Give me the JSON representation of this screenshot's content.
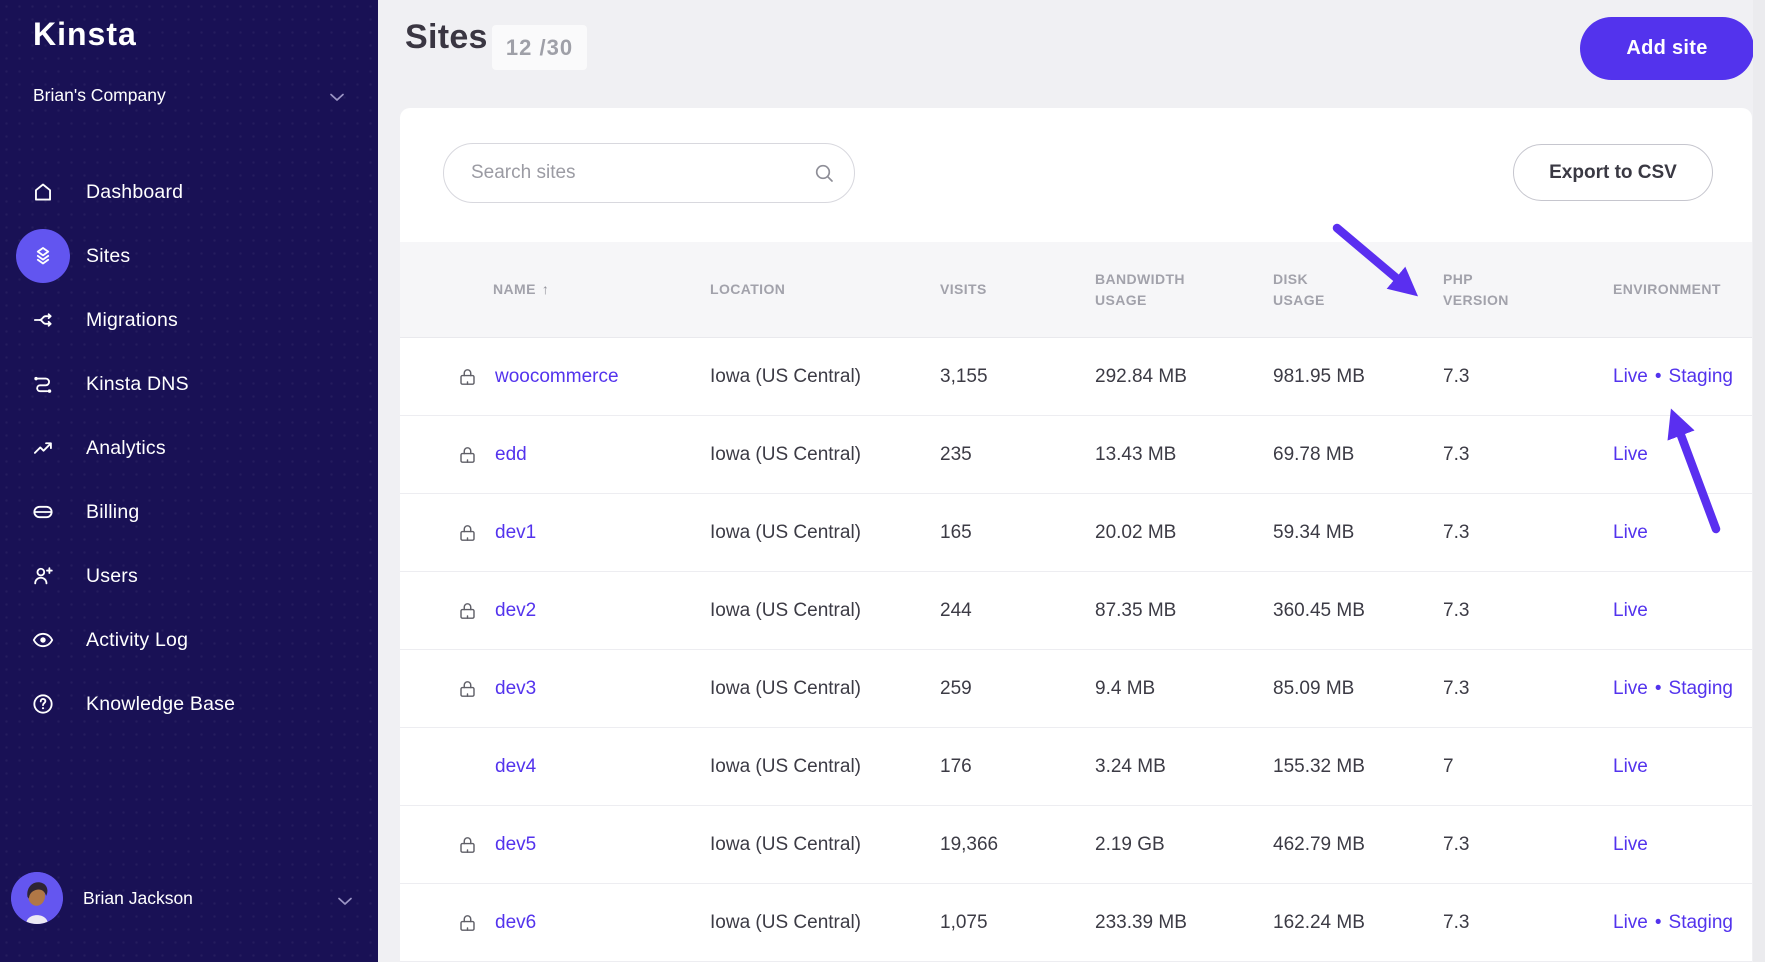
{
  "brand": {
    "logo_text": "Kinsta"
  },
  "workspace": {
    "company_name": "Brian's Company"
  },
  "sidebar": {
    "items": [
      {
        "label": "Dashboard",
        "icon": "home",
        "active": false
      },
      {
        "label": "Sites",
        "icon": "sites-layers",
        "active": true
      },
      {
        "label": "Migrations",
        "icon": "migration-branch",
        "active": false
      },
      {
        "label": "Kinsta DNS",
        "icon": "dns-route",
        "active": false
      },
      {
        "label": "Analytics",
        "icon": "trend-up",
        "active": false
      },
      {
        "label": "Billing",
        "icon": "credit-card",
        "active": false
      },
      {
        "label": "Users",
        "icon": "user-plus",
        "active": false
      },
      {
        "label": "Activity Log",
        "icon": "eye",
        "active": false
      },
      {
        "label": "Knowledge Base",
        "icon": "help-circle",
        "active": false
      }
    ],
    "user": {
      "name": "Brian Jackson"
    }
  },
  "page": {
    "title": "Sites",
    "count_badge": "12 /30",
    "add_site_label": "Add site"
  },
  "toolbar": {
    "search_placeholder": "Search sites",
    "export_label": "Export to CSV"
  },
  "table": {
    "sort_arrow": "↑",
    "env_separator": "•",
    "columns": [
      {
        "label": "Name",
        "sorted": "asc"
      },
      {
        "label": "Location"
      },
      {
        "label": "Visits"
      },
      {
        "line1": "Bandwidth",
        "line2": "Usage"
      },
      {
        "line1": "Disk",
        "line2": "Usage"
      },
      {
        "line1": "PHP",
        "line2": "Version"
      },
      {
        "label": "Environment"
      }
    ],
    "rows": [
      {
        "name": "woocommerce",
        "locked": true,
        "location": "Iowa (US Central)",
        "visits": "3,155",
        "bandwidth": "292.84 MB",
        "disk": "981.95 MB",
        "php": "7.3",
        "environments": [
          "Live",
          "Staging"
        ]
      },
      {
        "name": "edd",
        "locked": true,
        "location": "Iowa (US Central)",
        "visits": "235",
        "bandwidth": "13.43 MB",
        "disk": "69.78 MB",
        "php": "7.3",
        "environments": [
          "Live"
        ]
      },
      {
        "name": "dev1",
        "locked": true,
        "location": "Iowa (US Central)",
        "visits": "165",
        "bandwidth": "20.02 MB",
        "disk": "59.34 MB",
        "php": "7.3",
        "environments": [
          "Live"
        ]
      },
      {
        "name": "dev2",
        "locked": true,
        "location": "Iowa (US Central)",
        "visits": "244",
        "bandwidth": "87.35 MB",
        "disk": "360.45 MB",
        "php": "7.3",
        "environments": [
          "Live"
        ]
      },
      {
        "name": "dev3",
        "locked": true,
        "location": "Iowa (US Central)",
        "visits": "259",
        "bandwidth": "9.4 MB",
        "disk": "85.09 MB",
        "php": "7.3",
        "environments": [
          "Live",
          "Staging"
        ]
      },
      {
        "name": "dev4",
        "locked": false,
        "location": "Iowa (US Central)",
        "visits": "176",
        "bandwidth": "3.24 MB",
        "disk": "155.32 MB",
        "php": "7",
        "environments": [
          "Live"
        ]
      },
      {
        "name": "dev5",
        "locked": true,
        "location": "Iowa (US Central)",
        "visits": "19,366",
        "bandwidth": "2.19 GB",
        "disk": "462.79 MB",
        "php": "7.3",
        "environments": [
          "Live"
        ]
      },
      {
        "name": "dev6",
        "locked": true,
        "location": "Iowa (US Central)",
        "visits": "1,075",
        "bandwidth": "233.39 MB",
        "disk": "162.24 MB",
        "php": "7.3",
        "environments": [
          "Live",
          "Staging"
        ]
      }
    ]
  },
  "annotations": {
    "arrow_color": "#5a2ff0",
    "arrows": [
      {
        "points_to": "PHP Version column header"
      },
      {
        "points_to": "Live • Staging environment links of woocommerce row"
      }
    ]
  },
  "colors": {
    "brand_purple": "#5333ed",
    "sidebar_bg": "#191155",
    "active_item_bg": "#6255f0",
    "link_purple": "#5333ed",
    "page_bg": "#f0f0f3",
    "table_header_bg": "#f6f6f8"
  }
}
